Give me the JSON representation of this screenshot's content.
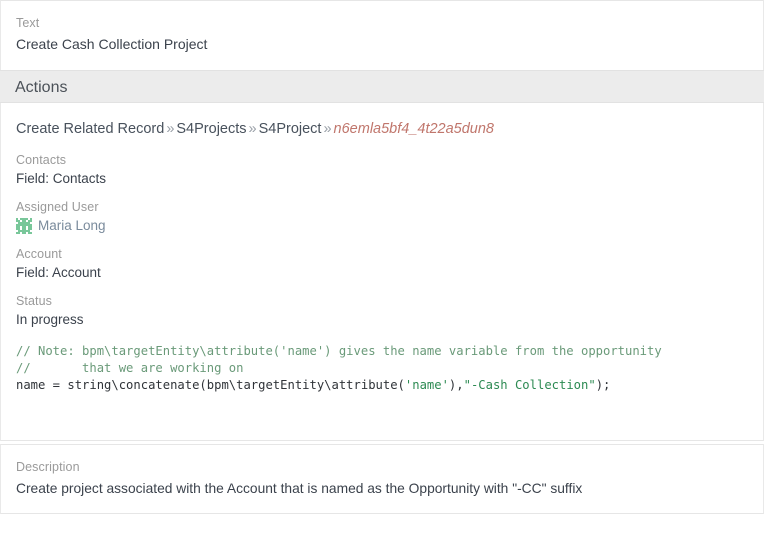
{
  "text_panel": {
    "label": "Text",
    "value": "Create Cash Collection Project"
  },
  "actions": {
    "header": "Actions",
    "breadcrumb": {
      "crumb1": "Create Related Record",
      "sep1": "»",
      "crumb2": "S4Projects",
      "sep2": "»",
      "crumb3": "S4Project",
      "sep3": "»",
      "record_id": "n6emla5bf4_4t22a5dun8"
    },
    "fields": [
      {
        "label": "Contacts",
        "value": "Field: Contacts"
      },
      {
        "label": "Assigned User",
        "value": "Maria Long"
      },
      {
        "label": "Account",
        "value": "Field: Account"
      },
      {
        "label": "Status",
        "value": "In progress"
      }
    ],
    "contacts": {
      "label": "Contacts",
      "value": "Field: Contacts"
    },
    "assigned_user": {
      "label": "Assigned User",
      "value": "Maria Long",
      "avatar_icon": "identicon-avatar"
    },
    "account": {
      "label": "Account",
      "value": "Field: Account"
    },
    "status": {
      "label": "Status",
      "value": "In progress"
    },
    "code": {
      "line1_comment": "// Note: bpm\\targetEntity\\attribute('name') gives the name variable from the opportunity",
      "line2_comment": "//       that we are working on",
      "line3_a": "name = string\\concatenate(bpm\\targetEntity\\attribute(",
      "line3_b": "'name'",
      "line3_c": "),",
      "line3_d": "\"-Cash Collection\"",
      "line3_e": ");"
    }
  },
  "description": {
    "label": "Description",
    "value": "Create project associated with the Account that is named as the Opportunity with \"-CC\" suffix"
  },
  "colors": {
    "band_bg": "#ececec",
    "label_gray": "#9a9a9a",
    "text_dark": "#3b424c",
    "record_id_red": "#c0766c",
    "link_blue": "#7a8b9c",
    "comment_green": "#6a9a79",
    "string_green": "#2c8a52",
    "avatar_green": "#79c79a"
  }
}
